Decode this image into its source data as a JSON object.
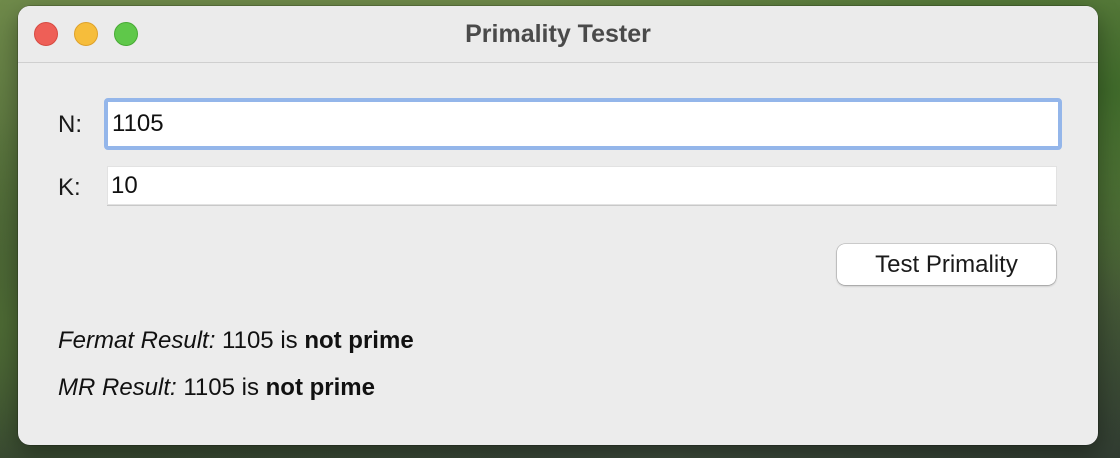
{
  "window": {
    "title": "Primality Tester"
  },
  "form": {
    "n_label": "N:",
    "n_value": "1105",
    "k_label": "K:",
    "k_value": "10",
    "test_button_label": "Test Primality"
  },
  "results": {
    "fermat": {
      "label": "Fermat Result:",
      "middle": " 1105 is ",
      "verdict": "not prime"
    },
    "mr": {
      "label": "MR Result:",
      "middle": " 1105 is ",
      "verdict": "not prime"
    }
  },
  "colors": {
    "close": "#ee5f57",
    "minimize": "#f6bd3b",
    "maximize": "#5fc84a",
    "focus_ring": "#94b6ea"
  }
}
